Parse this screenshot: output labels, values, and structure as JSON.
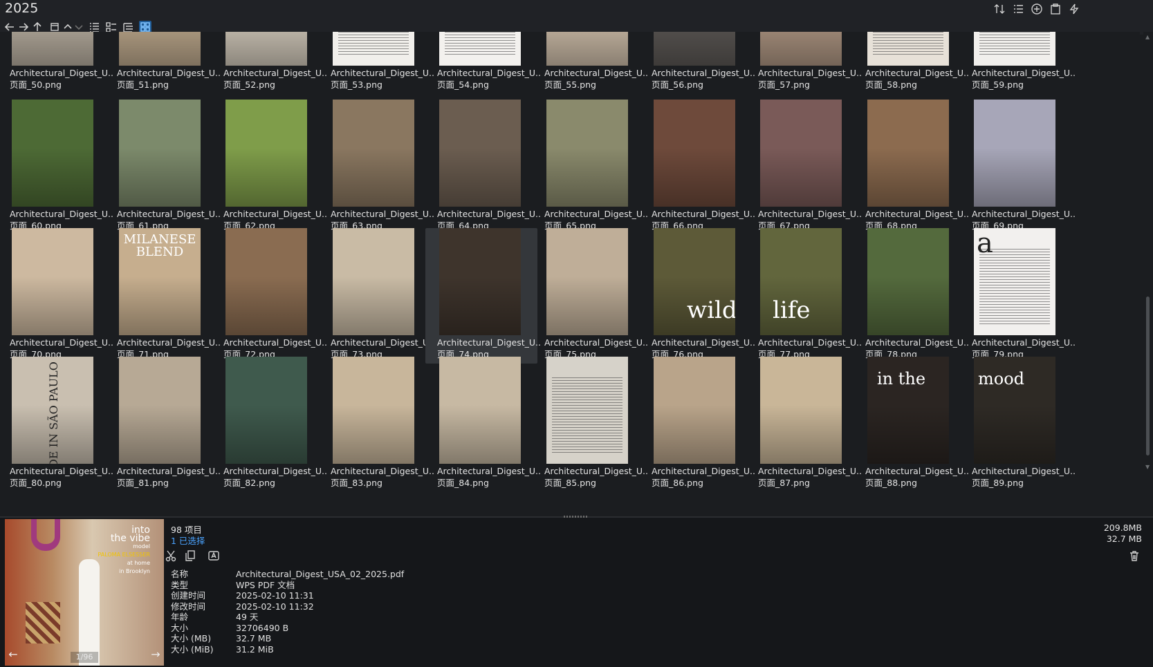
{
  "window": {
    "title": "2025"
  },
  "toolbar": {
    "back": "back-arrow-icon",
    "forward": "forward-arrow-icon",
    "up": "up-arrow-icon",
    "view_mode_selected": "grid-view-icon"
  },
  "files": [
    {
      "line1": "Architectural_Digest_U...",
      "line2": "页面_50.png",
      "bg": "#bdb3a4"
    },
    {
      "line1": "Architectural_Digest_U...",
      "line2": "页面_51.png",
      "bg": "#c2ad90"
    },
    {
      "line1": "Architectural_Digest_U...",
      "line2": "页面_52.png",
      "bg": "#d8cfc0"
    },
    {
      "line1": "Architectural_Digest_U...",
      "line2": "页面_53.png",
      "bg": "#f1efeb"
    },
    {
      "line1": "Architectural_Digest_U...",
      "line2": "页面_54.png",
      "bg": "#f3f1ee"
    },
    {
      "line1": "Architectural_Digest_U...",
      "line2": "页面_55.png",
      "bg": "#d4c3ae"
    },
    {
      "line1": "Architectural_Digest_U...",
      "line2": "页面_56.png",
      "bg": "#5e5a57"
    },
    {
      "line1": "Architectural_Digest_U...",
      "line2": "页面_57.png",
      "bg": "#b39a86"
    },
    {
      "line1": "Architectural_Digest_U...",
      "line2": "页面_58.png",
      "bg": "#e7e1d8"
    },
    {
      "line1": "Architectural_Digest_U...",
      "line2": "页面_59.png",
      "bg": "#f1efec"
    },
    {
      "line1": "Architectural_Digest_U...",
      "line2": "页面_60.png",
      "bg": "#4d6a35"
    },
    {
      "line1": "Architectural_Digest_U...",
      "line2": "页面_61.png",
      "bg": "#7c8a6b"
    },
    {
      "line1": "Architectural_Digest_U...",
      "line2": "页面_62.png",
      "bg": "#7f9d4a"
    },
    {
      "line1": "Architectural_Digest_U...",
      "line2": "页面_63.png",
      "bg": "#8a7760"
    },
    {
      "line1": "Architectural_Digest_U...",
      "line2": "页面_64.png",
      "bg": "#6b5d50"
    },
    {
      "line1": "Architectural_Digest_U...",
      "line2": "页面_65.png",
      "bg": "#8a8a6c"
    },
    {
      "line1": "Architectural_Digest_U...",
      "line2": "页面_66.png",
      "bg": "#6e4a3b"
    },
    {
      "line1": "Architectural_Digest_U...",
      "line2": "页面_67.png",
      "bg": "#7a5a58"
    },
    {
      "line1": "Architectural_Digest_U...",
      "line2": "页面_68.png",
      "bg": "#8c6b4f"
    },
    {
      "line1": "Architectural_Digest_U...",
      "line2": "页面_69.png",
      "bg": "#a7a6b8"
    },
    {
      "line1": "Architectural_Digest_U...",
      "line2": "页面_70.png",
      "bg": "#cdb9a0"
    },
    {
      "line1": "Architectural_Digest_U...",
      "line2": "页面_71.png",
      "bg": "#c6ae8e"
    },
    {
      "line1": "Architectural_Digest_U...",
      "line2": "页面_72.png",
      "bg": "#8a6c51"
    },
    {
      "line1": "Architectural_Digest_U...",
      "line2": "页面_73.png",
      "bg": "#c9bba5"
    },
    {
      "line1": "Architectural_Digest_U...",
      "line2": "页面_74.png",
      "bg": "#3e342c"
    },
    {
      "line1": "Architectural_Digest_U...",
      "line2": "页面_75.png",
      "bg": "#bfae98"
    },
    {
      "line1": "Architectural_Digest_U...",
      "line2": "页面_76.png",
      "bg": "#5d5a38"
    },
    {
      "line1": "Architectural_Digest_U...",
      "line2": "页面_77.png",
      "bg": "#62663d"
    },
    {
      "line1": "Architectural_Digest_U...",
      "line2": "页面_78.png",
      "bg": "#546a3d"
    },
    {
      "line1": "Architectural_Digest_U...",
      "line2": "页面_79.png",
      "bg": "#f2f0ee"
    },
    {
      "line1": "Architectural_Digest_U...",
      "line2": "页面_80.png",
      "bg": "#c9bfb0"
    },
    {
      "line1": "Architectural_Digest_U...",
      "line2": "页面_81.png",
      "bg": "#b7a995"
    },
    {
      "line1": "Architectural_Digest_U...",
      "line2": "页面_82.png",
      "bg": "#3f5a4d"
    },
    {
      "line1": "Architectural_Digest_U...",
      "line2": "页面_83.png",
      "bg": "#c8b69b"
    },
    {
      "line1": "Architectural_Digest_U...",
      "line2": "页面_84.png",
      "bg": "#c7b9a3"
    },
    {
      "line1": "Architectural_Digest_U...",
      "line2": "页面_85.png",
      "bg": "#d6d2c9"
    },
    {
      "line1": "Architectural_Digest_U...",
      "line2": "页面_86.png",
      "bg": "#b9a48a"
    },
    {
      "line1": "Architectural_Digest_U...",
      "line2": "页面_87.png",
      "bg": "#c9b698"
    },
    {
      "line1": "Architectural_Digest_U...",
      "line2": "页面_88.png",
      "bg": "#2b2522"
    },
    {
      "line1": "Architectural_Digest_U...",
      "line2": "页面_89.png",
      "bg": "#2e2a25"
    }
  ],
  "thumb_text": {
    "wild": "wild",
    "life": "life",
    "milanese": "MILANESE BLEND",
    "in_the": "in the",
    "mood": "mood",
    "a": "a",
    "made_in": "MADE IN SÃO PAULO"
  },
  "selected_file_index": 24,
  "details": {
    "item_count": "98 项目",
    "selected_count": "1 已选择",
    "total_size": "209.8MB",
    "selected_size": "32.7 MB",
    "page_indicator": "1/96",
    "preview_text": {
      "line1": "into",
      "line2": "the vibe",
      "line3": "model",
      "line4": "PALOMA ELSESSER",
      "line5": "at home",
      "line6": "in Brooklyn"
    },
    "props": [
      {
        "label": "名称",
        "value": "Architectural_Digest_USA_02_2025.pdf"
      },
      {
        "label": "类型",
        "value": "WPS PDF 文档"
      },
      {
        "label": "创建时间",
        "value": "2025-02-10  11:31"
      },
      {
        "label": "修改时间",
        "value": "2025-02-10  11:32"
      },
      {
        "label": "年龄",
        "value": "49 天"
      },
      {
        "label": "大小",
        "value": "32706490 B"
      },
      {
        "label": "大小 (MB)",
        "value": "32.7 MB"
      },
      {
        "label": "大小 (MiB)",
        "value": "31.2 MiB"
      }
    ]
  },
  "colors": {
    "background": "#1b1d20",
    "panel": "#15171a",
    "accent": "#4aa3ff",
    "selected_tile": "#34373b"
  }
}
